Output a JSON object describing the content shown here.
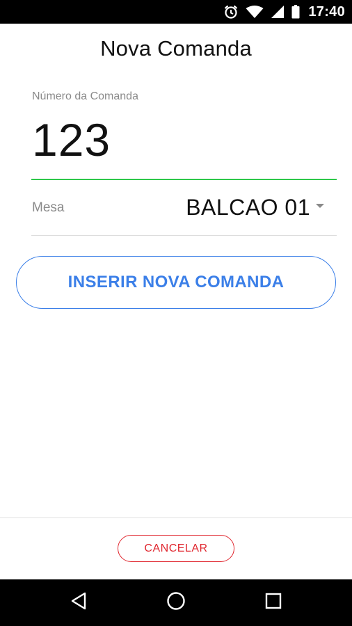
{
  "status_bar": {
    "time": "17:40",
    "icons": [
      "alarm-icon",
      "wifi-icon",
      "signal-icon",
      "battery-icon"
    ]
  },
  "header": {
    "title": "Nova Comanda"
  },
  "form": {
    "comanda": {
      "label": "Número da Comanda",
      "value": "123"
    },
    "mesa": {
      "label": "Mesa",
      "selected": "BALCAO 01"
    },
    "submit_label": "INSERIR NOVA COMANDA"
  },
  "footer": {
    "cancel_label": "CANCELAR"
  },
  "nav_bar": {
    "icons": [
      "back-icon",
      "home-icon",
      "recents-icon"
    ]
  },
  "colors": {
    "accent_blue": "#3b7fe8",
    "input_underline_green": "#2ec84a",
    "cancel_red": "#e0272f"
  }
}
